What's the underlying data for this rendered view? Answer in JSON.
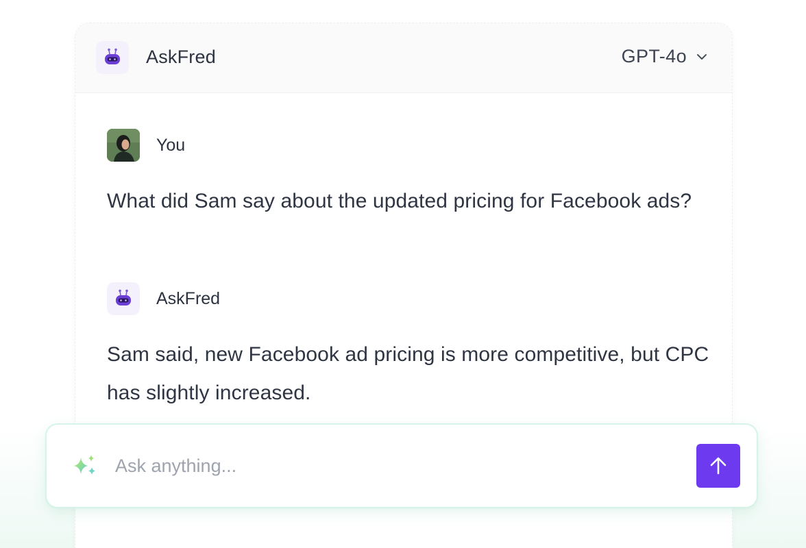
{
  "header": {
    "title": "AskFred",
    "model": "GPT-4o",
    "bot_icon": "robot-icon",
    "dropdown_icon": "chevron-down-icon"
  },
  "messages": [
    {
      "sender": "You",
      "avatar": "user-photo-avatar",
      "text": "What did Sam say about the updated pricing for Facebook ads?"
    },
    {
      "sender": "AskFred",
      "avatar": "robot-icon",
      "text": "Sam said, new Facebook ad pricing is more competitive, but CPC has slightly increased."
    }
  ],
  "composer": {
    "placeholder": "Ask anything...",
    "value": "",
    "leading_icon": "sparkle-icon",
    "send_icon": "arrow-up-icon"
  },
  "colors": {
    "accent": "#6d3af0",
    "bot_body": "#6b3fd6",
    "bot_bg": "#f4f1fd",
    "text": "#2f3542",
    "muted": "#9ea3ad"
  }
}
